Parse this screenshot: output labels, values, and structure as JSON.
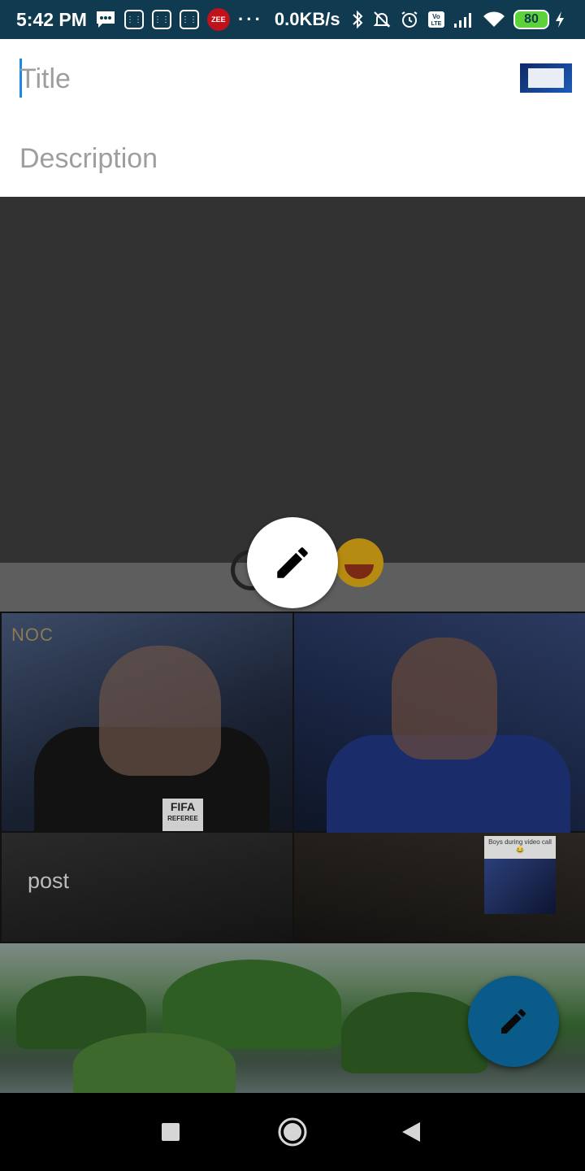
{
  "status_bar": {
    "time": "5:42 PM",
    "zee_label": "ZEE",
    "dots": "···",
    "network_speed": "0.0KB/s",
    "volte_label": "Vo LTE",
    "battery_level": "80",
    "icons": [
      "message-icon",
      "sim-icon",
      "sim-icon",
      "sim-icon",
      "zee-app-icon",
      "bluetooth-icon",
      "bell-off-icon",
      "alarm-icon",
      "volte-icon",
      "signal-icon",
      "wifi-icon",
      "battery-icon",
      "charging-icon"
    ]
  },
  "form": {
    "title_placeholder": "Title",
    "description_placeholder": "Description"
  },
  "background_feed": {
    "noc_text": "NOC",
    "fifa_text": "FIFA",
    "referee_text": "REFEREE",
    "post_label": "post",
    "mini_card_caption": "Boys during video call 😂"
  },
  "buttons": {
    "edit_icon": "pencil-icon",
    "fab_icon": "pencil-icon",
    "fab_color": "#0b5b8a"
  },
  "nav_bar": {
    "icons": [
      "recents-square-icon",
      "home-circle-icon",
      "back-triangle-icon"
    ]
  }
}
